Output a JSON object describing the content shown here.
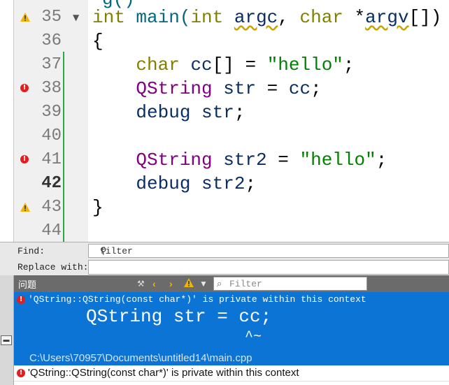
{
  "editor": {
    "partial_top": "g()",
    "lines": [
      {
        "number": "35",
        "marker": "warning",
        "fold": "▼",
        "tokens": [
          {
            "t": "int",
            "c": "kw"
          },
          {
            "t": " main(",
            "c": "fn"
          },
          {
            "t": "int",
            "c": "kw"
          },
          {
            "t": " ",
            "c": ""
          },
          {
            "t": "argc",
            "c": "id ul"
          },
          {
            "t": ", ",
            "c": ""
          },
          {
            "t": "char",
            "c": "kw"
          },
          {
            "t": " *",
            "c": ""
          },
          {
            "t": "argv",
            "c": "id ul"
          },
          {
            "t": "[])",
            "c": ""
          }
        ]
      },
      {
        "number": "36",
        "marker": "",
        "fold": "",
        "tokens": [
          {
            "t": "{",
            "c": ""
          }
        ]
      },
      {
        "number": "37",
        "marker": "",
        "fold": "",
        "tokens": [
          {
            "t": "    ",
            "c": ""
          },
          {
            "t": "char",
            "c": "kw"
          },
          {
            "t": " ",
            "c": ""
          },
          {
            "t": "cc",
            "c": "id"
          },
          {
            "t": "[] = ",
            "c": ""
          },
          {
            "t": "\"hello\"",
            "c": "st"
          },
          {
            "t": ";",
            "c": ""
          }
        ]
      },
      {
        "number": "38",
        "marker": "error",
        "fold": "",
        "tokens": [
          {
            "t": "    ",
            "c": ""
          },
          {
            "t": "QString",
            "c": "ty"
          },
          {
            "t": " ",
            "c": ""
          },
          {
            "t": "str",
            "c": "id"
          },
          {
            "t": " = ",
            "c": ""
          },
          {
            "t": "cc",
            "c": "id"
          },
          {
            "t": ";",
            "c": ""
          }
        ]
      },
      {
        "number": "39",
        "marker": "",
        "fold": "",
        "tokens": [
          {
            "t": "    ",
            "c": ""
          },
          {
            "t": "debug",
            "c": "id"
          },
          {
            "t": " ",
            "c": ""
          },
          {
            "t": "str",
            "c": "id"
          },
          {
            "t": ";",
            "c": ""
          }
        ]
      },
      {
        "number": "40",
        "marker": "",
        "fold": "",
        "tokens": []
      },
      {
        "number": "41",
        "marker": "error",
        "fold": "",
        "tokens": [
          {
            "t": "    ",
            "c": ""
          },
          {
            "t": "QString",
            "c": "ty"
          },
          {
            "t": " ",
            "c": ""
          },
          {
            "t": "str2",
            "c": "id"
          },
          {
            "t": " = ",
            "c": ""
          },
          {
            "t": "\"hello\"",
            "c": "st"
          },
          {
            "t": ";",
            "c": ""
          }
        ]
      },
      {
        "number": "42",
        "marker": "",
        "fold": "",
        "current": true,
        "tokens": [
          {
            "t": "    ",
            "c": ""
          },
          {
            "t": "debug",
            "c": "id"
          },
          {
            "t": " ",
            "c": ""
          },
          {
            "t": "str2",
            "c": "id"
          },
          {
            "t": ";",
            "c": ""
          }
        ]
      },
      {
        "number": "43",
        "marker": "warning",
        "fold": "",
        "tokens": [
          {
            "t": "}",
            "c": ""
          }
        ]
      },
      {
        "number": "44",
        "marker": "",
        "fold": "",
        "tokens": []
      }
    ]
  },
  "find_bar": {
    "find_label": "Find:",
    "find_value": "filter",
    "replace_label": "Replace with:",
    "replace_value": ""
  },
  "issues": {
    "title": "问题",
    "filter_placeholder": "Filter",
    "toolbar_icons": [
      "build-icon",
      "prev-icon",
      "next-icon",
      "warning-filter-icon",
      "funnel-icon"
    ],
    "selected": {
      "message": "'QString::QString(const char*)' is private within this context",
      "code": "QString str = cc;",
      "caret": "^~",
      "path": "C:\\Users\\70957\\Documents\\untitled14\\main.cpp"
    },
    "second": {
      "message": "'QString::QString(const char*)' is private within this context"
    }
  },
  "colors": {
    "keyword": "#808000",
    "type": "#800080",
    "string": "#008000",
    "identifier": "#092e64",
    "selection": "#0b74d4",
    "error": "#e02020",
    "warning": "#f0b400"
  }
}
